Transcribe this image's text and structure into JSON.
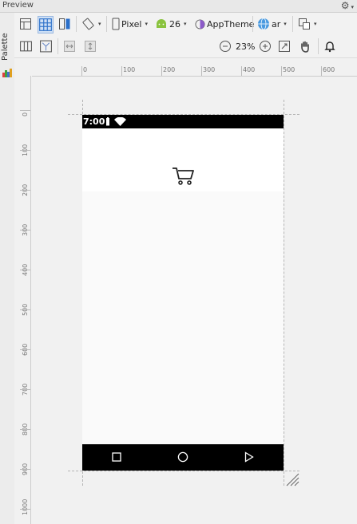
{
  "panel": {
    "title": "Preview"
  },
  "sidebar": {
    "palette_label": "Palette"
  },
  "toolbar1": {
    "device_label": "Pixel",
    "api_label": "26",
    "theme_label": "AppTheme",
    "locale_label": "ar"
  },
  "toolbar2": {
    "zoom_label": "23%"
  },
  "ruler": {
    "top_ticks": [
      "0",
      "100",
      "200",
      "300",
      "400",
      "500",
      "600"
    ],
    "left_ticks": [
      "0",
      "100",
      "200",
      "300",
      "400",
      "500",
      "600",
      "700",
      "800",
      "900",
      "1000"
    ]
  },
  "phone": {
    "status_time": "7:00"
  },
  "icons": [
    "gear-icon",
    "palette-icon",
    "design-view-icon",
    "blueprint-view-icon",
    "split-view-icon",
    "orientation-icon",
    "device-icon",
    "android-icon",
    "theme-icon",
    "globe-icon",
    "layout-variants-icon",
    "columns-icon",
    "constraints-icon",
    "expand-horizontal-icon",
    "expand-vertical-icon",
    "zoom-out-icon",
    "zoom-in-icon",
    "zoom-fit-icon",
    "pan-icon",
    "bell-icon",
    "battery-icon",
    "wifi-icon",
    "cart-icon",
    "back-icon",
    "home-icon",
    "recents-icon",
    "resize-handle-icon"
  ]
}
